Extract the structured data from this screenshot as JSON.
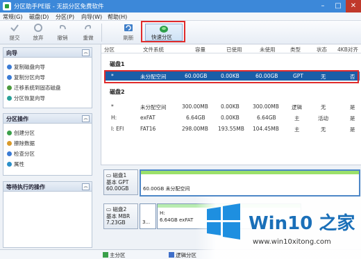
{
  "window": {
    "title": "分区助手PE版 - 无损分区免费软件"
  },
  "menu": {
    "items": [
      "常规(G)",
      "磁盘(D)",
      "分区(P)",
      "向导(W)",
      "帮助(H)"
    ]
  },
  "toolbar": {
    "submit": "提交",
    "discard": "放弃",
    "undo": "撤销",
    "redo": "重做",
    "refresh": "刷新",
    "quick_partition": "快速分区"
  },
  "wizard_panel": {
    "title": "向导",
    "items": [
      "复制磁盘向导",
      "复制分区向导",
      "迁移系统到固态磁盘",
      "分区恢复向导"
    ]
  },
  "ops_panel": {
    "title": "分区操作",
    "items": [
      "创建分区",
      "擦除数据",
      "检查分区",
      "属性"
    ]
  },
  "pending_panel": {
    "title": "等待执行的操作"
  },
  "table": {
    "headers": [
      "分区",
      "文件系统",
      "容量",
      "已使用",
      "未使用",
      "类型",
      "状态",
      "4KB对齐"
    ],
    "disk1_label": "磁盘1",
    "disk1_row": {
      "part": "*",
      "fs": "未分配空间",
      "cap": "60.00GB",
      "used": "0.00KB",
      "free": "60.00GB",
      "type": "GPT",
      "status": "无",
      "align": "否"
    },
    "disk2_label": "磁盘2",
    "disk2_rows": [
      {
        "part": "*",
        "fs": "未分配空间",
        "cap": "300.00MB",
        "used": "0.00KB",
        "free": "300.00MB",
        "type": "逻辑",
        "status": "无",
        "align": "是"
      },
      {
        "part": "H:",
        "fs": "exFAT",
        "cap": "6.64GB",
        "used": "0.00KB",
        "free": "6.64GB",
        "type": "主",
        "status": "活动",
        "align": "是"
      },
      {
        "part": "I: EFI",
        "fs": "FAT16",
        "cap": "298.00MB",
        "used": "193.55MB",
        "free": "104.45MB",
        "type": "主",
        "status": "无",
        "align": "是"
      }
    ]
  },
  "diskmap": {
    "disk1": {
      "name": "磁盘1",
      "kind": "基本 GPT",
      "size": "60.00GB",
      "bar": "60.00GB 未分配空间"
    },
    "disk2": {
      "name": "磁盘2",
      "kind": "基本 MBR",
      "size": "7.23GB",
      "bar_small": "3...",
      "bar_label": "H:",
      "bar_detail": "6.64GB exFAT"
    }
  },
  "status": {
    "primary": "主分区",
    "logical": "逻辑分区"
  },
  "watermark": {
    "brand": "Win10 之家",
    "url": "www.win10xitong.com"
  },
  "colors": {
    "accent": "#3c88d9",
    "selected": "#1a5ea8",
    "highlight_box": "#e02b2b",
    "used": "#7fd04a"
  }
}
